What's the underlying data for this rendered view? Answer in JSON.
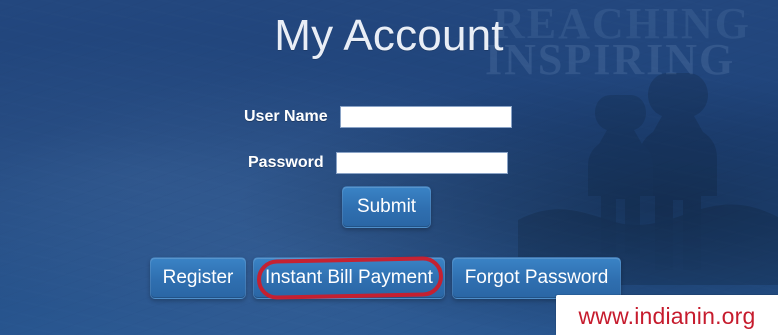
{
  "page": {
    "title": "My Account",
    "background_watermark": {
      "line1": "REACHING",
      "line2": "INSPIRING"
    }
  },
  "form": {
    "username_label": "User Name",
    "password_label": "Password",
    "username_value": "",
    "password_value": "",
    "submit_label": "Submit"
  },
  "actions": {
    "register_label": "Register",
    "instant_bill_payment_label": "Instant Bill Payment",
    "forgot_password_label": "Forgot Password"
  },
  "watermark": {
    "text": "www.indianin.org"
  },
  "colors": {
    "background_blue": "#1f3f73",
    "button_blue": "#2f6fb0",
    "annotation_red": "#cc1c2a",
    "watermark_red": "#c61b2d"
  }
}
